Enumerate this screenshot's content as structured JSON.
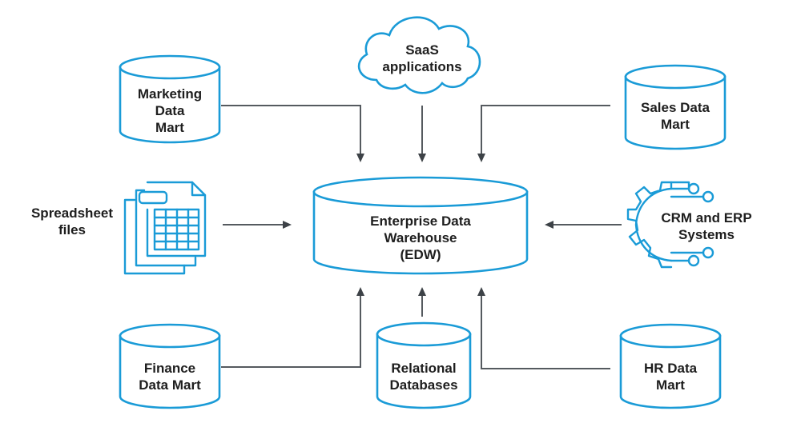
{
  "diagram": {
    "title": "",
    "colors": {
      "node_stroke": "#1a9bd7",
      "connector": "#555a5f",
      "text": "#1e1e1e"
    },
    "center": {
      "id": "edw",
      "shape": "cylinder",
      "lines": [
        "Enterprise Data",
        "Warehouse",
        "(EDW)"
      ]
    },
    "sources": [
      {
        "id": "marketing",
        "shape": "cylinder",
        "lines": [
          "Marketing",
          "Data",
          "Mart"
        ],
        "position": "top-left"
      },
      {
        "id": "saas",
        "shape": "cloud",
        "lines": [
          "SaaS",
          "applications"
        ],
        "position": "top-center"
      },
      {
        "id": "sales",
        "shape": "cylinder",
        "lines": [
          "Sales Data",
          "Mart"
        ],
        "position": "top-right"
      },
      {
        "id": "spreadsheet",
        "shape": "spreadsheet-icon",
        "lines": [
          "Spreadsheet",
          "files"
        ],
        "position": "middle-left"
      },
      {
        "id": "crm-erp",
        "shape": "gear-circuit-icon",
        "lines": [
          "CRM and ERP",
          "Systems"
        ],
        "position": "middle-right"
      },
      {
        "id": "finance",
        "shape": "cylinder",
        "lines": [
          "Finance",
          "Data Mart"
        ],
        "position": "bottom-left"
      },
      {
        "id": "relational",
        "shape": "cylinder",
        "lines": [
          "Relational",
          "Databases"
        ],
        "position": "bottom-center"
      },
      {
        "id": "hr",
        "shape": "cylinder",
        "lines": [
          "HR Data",
          "Mart"
        ],
        "position": "bottom-right"
      }
    ],
    "edges": [
      {
        "from": "marketing",
        "to": "edw"
      },
      {
        "from": "saas",
        "to": "edw"
      },
      {
        "from": "sales",
        "to": "edw"
      },
      {
        "from": "spreadsheet",
        "to": "edw"
      },
      {
        "from": "crm-erp",
        "to": "edw"
      },
      {
        "from": "finance",
        "to": "edw"
      },
      {
        "from": "relational",
        "to": "edw"
      },
      {
        "from": "hr",
        "to": "edw"
      }
    ]
  }
}
